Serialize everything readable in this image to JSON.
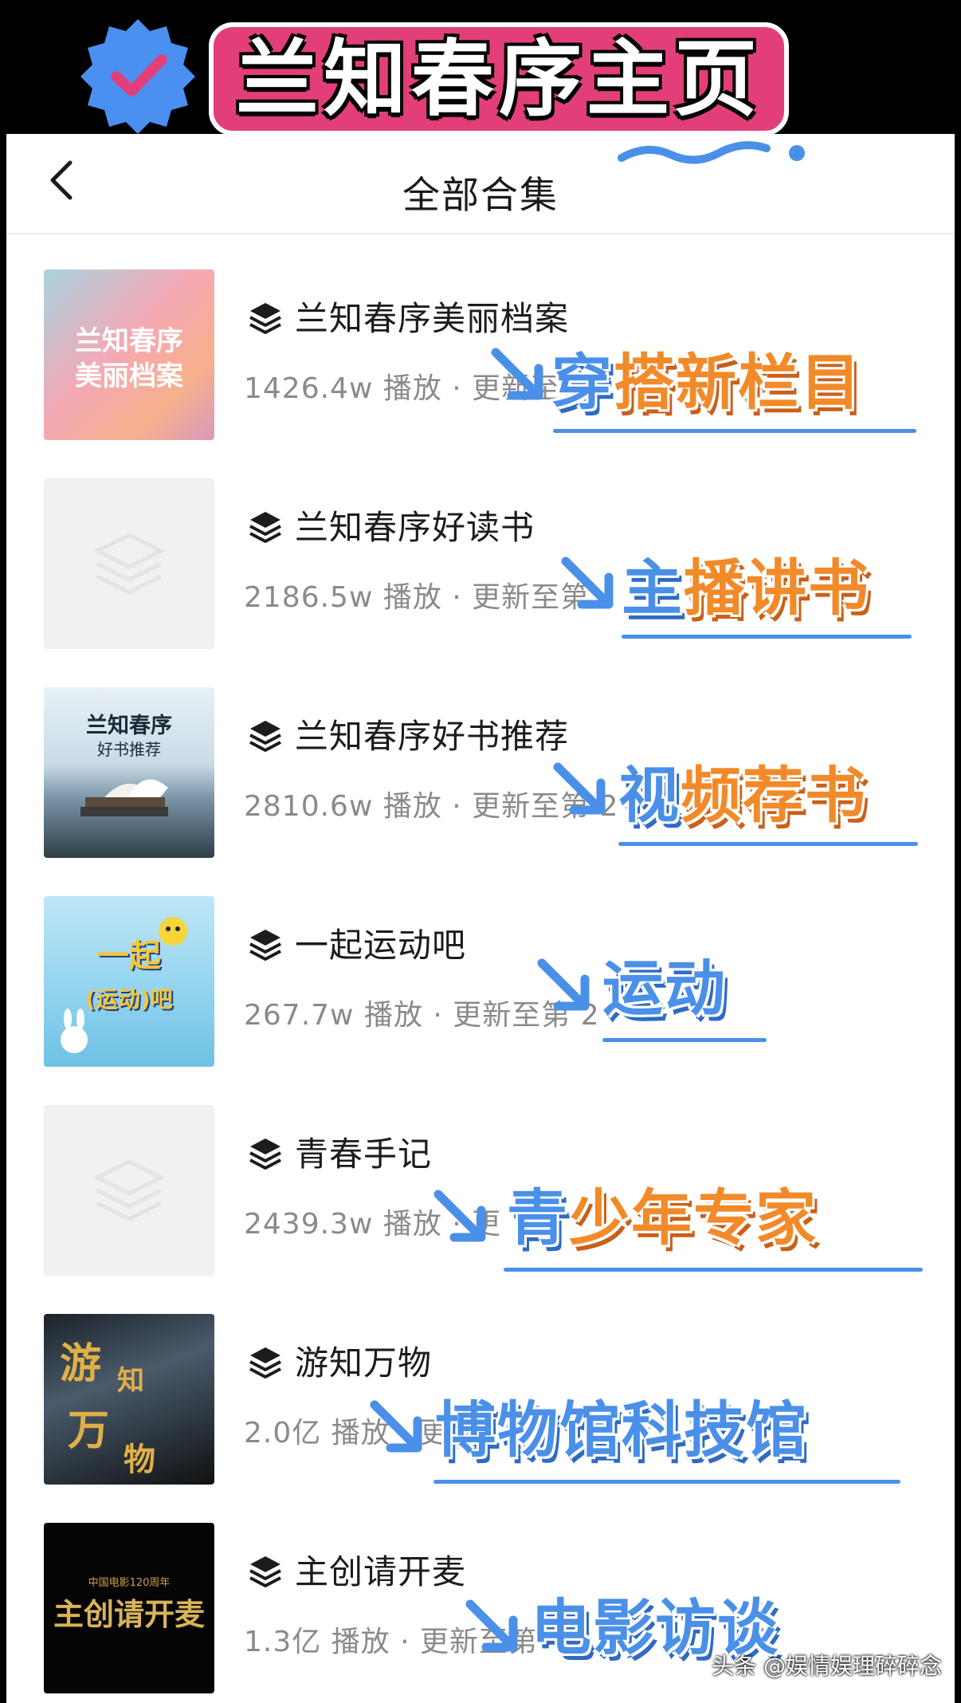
{
  "banner": {
    "title": "兰知春序主页",
    "badge_icon": "verified-check-icon",
    "accent_color": "#e23f7a"
  },
  "nav": {
    "title": "全部合集",
    "back_icon": "chevron-left-icon"
  },
  "collections": [
    {
      "title": "兰知春序美丽档案",
      "meta": "1426.4w 播放 · 更新至",
      "thumb_text": [
        "兰知春序",
        "美丽档案"
      ],
      "callout": [
        "穿",
        "搭",
        "新",
        "栏",
        "目"
      ],
      "callout_colors": [
        "blue",
        "orange",
        "orange",
        "orange",
        "orange"
      ]
    },
    {
      "title": "兰知春序好读书",
      "meta": "2186.5w 播放 · 更新至第",
      "thumb_text": [],
      "callout": [
        "主",
        "播",
        "讲",
        "书"
      ],
      "callout_colors": [
        "blue",
        "orange",
        "orange",
        "orange"
      ]
    },
    {
      "title": "兰知春序好书推荐",
      "meta": "2810.6w 播放 · 更新至第 2",
      "thumb_text": [
        "兰知春序",
        "好书推荐"
      ],
      "callout": [
        "视",
        "频",
        "荐",
        "书"
      ],
      "callout_colors": [
        "blue",
        "orange",
        "orange",
        "orange"
      ]
    },
    {
      "title": "一起运动吧",
      "meta": "267.7w 播放 · 更新至第 2",
      "thumb_text": [
        "一起",
        "(运动)吧"
      ],
      "callout": [
        "运",
        "动"
      ],
      "callout_colors": [
        "blue",
        "blue"
      ]
    },
    {
      "title": "青春手记",
      "meta": "2439.3w 播放 · 更",
      "thumb_text": [],
      "callout": [
        "青",
        "少",
        "年",
        "专",
        "家"
      ],
      "callout_colors": [
        "blue",
        "orange",
        "orange",
        "orange",
        "orange"
      ]
    },
    {
      "title": "游知万物",
      "meta": "2.0亿 播放 · 更",
      "thumb_text": [
        "游",
        "知",
        "万",
        "物"
      ],
      "callout": [
        "博",
        "物",
        "馆",
        "科",
        "技",
        "馆"
      ],
      "callout_colors": [
        "blue",
        "blue",
        "blue",
        "blue",
        "blue",
        "blue"
      ]
    },
    {
      "title": "主创请开麦",
      "meta": "1.3亿 播放 · 更新至第",
      "thumb_text": [
        "中国电影120周年",
        "主创请开麦"
      ],
      "callout": [
        "电",
        "影",
        "访",
        "谈"
      ],
      "callout_colors": [
        "blue",
        "blue",
        "blue",
        "blue"
      ]
    }
  ],
  "watermark": "头条 @娱情娱理碎碎念",
  "colors": {
    "callout_blue": "#4b90e8",
    "callout_orange": "#f28a2a",
    "meta_gray": "#8a8a8a"
  }
}
